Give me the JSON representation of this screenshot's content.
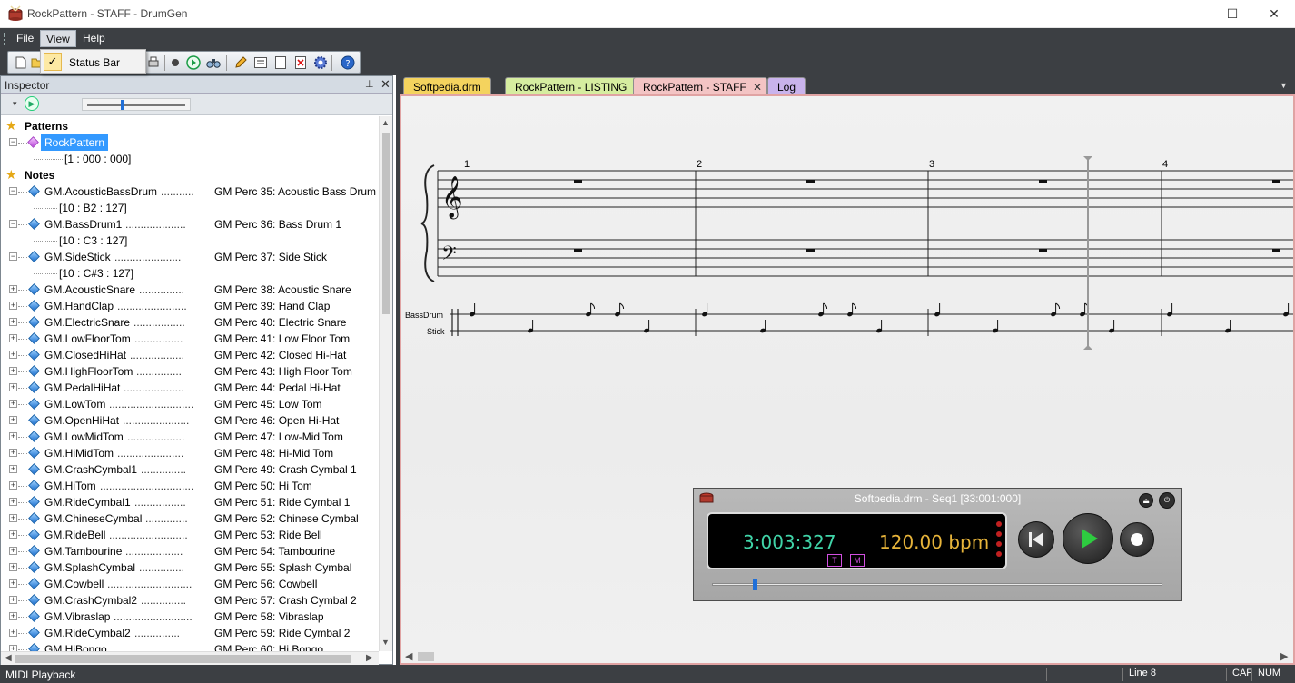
{
  "window": {
    "title": "RockPattern - STAFF - DrumGen",
    "minimize_glyph": "—",
    "maximize_glyph": "☐",
    "close_glyph": "✕"
  },
  "menu": {
    "items": [
      {
        "label": "File",
        "icon": "file-menu"
      },
      {
        "label": "View",
        "icon": "view-menu"
      },
      {
        "label": "Help",
        "icon": "help-menu"
      }
    ],
    "view_dropdown": {
      "checked_glyph": "✓",
      "item": "Status Bar"
    }
  },
  "toolbar": {
    "icons": [
      "new-file-icon",
      "open-folder-icon",
      "record-icon",
      "play-icon",
      "find-icon",
      "pencil-icon",
      "list-icon",
      "page-icon",
      "delete-icon",
      "settings-icon",
      "help-icon"
    ]
  },
  "inspector": {
    "title": "Inspector",
    "pin_glyph": "⊥",
    "close_glyph": "✕",
    "play_glyph": "▶",
    "dropdown_glyph": "▾",
    "tempo_slider_level": 0.36,
    "patterns_label": "Patterns",
    "pattern": {
      "name": "RockPattern",
      "detail": "[1 : 000 : 000]"
    },
    "notes_label": "Notes",
    "notes": [
      {
        "name": "GM.AcousticBassDrum",
        "dots": "...........",
        "desc": "GM Perc 35: Acoustic Bass Drum",
        "detail": "[10 : B2 : 127]"
      },
      {
        "name": "GM.BassDrum1",
        "dots": "....................",
        "desc": "GM Perc 36: Bass Drum 1",
        "detail": "[10 : C3 : 127]"
      },
      {
        "name": "GM.SideStick",
        "dots": "......................",
        "desc": "GM Perc 37: Side Stick",
        "detail": "[10 : C#3 : 127]"
      },
      {
        "name": "GM.AcousticSnare",
        "dots": "...............",
        "desc": "GM Perc 38: Acoustic Snare"
      },
      {
        "name": "GM.HandClap",
        "dots": ".......................",
        "desc": "GM Perc 39: Hand Clap"
      },
      {
        "name": "GM.ElectricSnare",
        "dots": ".................",
        "desc": "GM Perc 40: Electric Snare"
      },
      {
        "name": "GM.LowFloorTom",
        "dots": "................",
        "desc": "GM Perc 41: Low Floor Tom"
      },
      {
        "name": "GM.ClosedHiHat",
        "dots": "..................",
        "desc": "GM Perc 42: Closed Hi-Hat"
      },
      {
        "name": "GM.HighFloorTom",
        "dots": "...............",
        "desc": "GM Perc 43: High Floor Tom"
      },
      {
        "name": "GM.PedalHiHat",
        "dots": "....................",
        "desc": "GM Perc 44: Pedal Hi-Hat"
      },
      {
        "name": "GM.LowTom",
        "dots": "............................",
        "desc": "GM Perc 45: Low Tom"
      },
      {
        "name": "GM.OpenHiHat",
        "dots": "......................",
        "desc": "GM Perc 46: Open Hi-Hat"
      },
      {
        "name": "GM.LowMidTom",
        "dots": "...................",
        "desc": "GM Perc 47: Low-Mid Tom"
      },
      {
        "name": "GM.HiMidTom",
        "dots": "......................",
        "desc": "GM Perc 48: Hi-Mid Tom"
      },
      {
        "name": "GM.CrashCymbal1",
        "dots": "...............",
        "desc": "GM Perc 49: Crash Cymbal 1"
      },
      {
        "name": "GM.HiTom",
        "dots": "...............................",
        "desc": "GM Perc 50: Hi Tom"
      },
      {
        "name": "GM.RideCymbal1",
        "dots": ".................",
        "desc": "GM Perc 51: Ride Cymbal 1"
      },
      {
        "name": "GM.ChineseCymbal",
        "dots": "..............",
        "desc": "GM Perc 52: Chinese Cymbal"
      },
      {
        "name": "GM.RideBell",
        "dots": "..........................",
        "desc": "GM Perc 53: Ride Bell"
      },
      {
        "name": "GM.Tambourine",
        "dots": "...................",
        "desc": "GM Perc 54: Tambourine"
      },
      {
        "name": "GM.SplashCymbal",
        "dots": "...............",
        "desc": "GM Perc 55: Splash Cymbal"
      },
      {
        "name": "GM.Cowbell",
        "dots": "............................",
        "desc": "GM Perc 56: Cowbell"
      },
      {
        "name": "GM.CrashCymbal2",
        "dots": "...............",
        "desc": "GM Perc 57: Crash Cymbal 2"
      },
      {
        "name": "GM.Vibraslap",
        "dots": "..........................",
        "desc": "GM Perc 58: Vibraslap"
      },
      {
        "name": "GM.RideCymbal2",
        "dots": "...............",
        "desc": "GM Perc 59: Ride Cymbal 2"
      },
      {
        "name": "GM.HiBongo",
        "dots": "...........................",
        "desc": "GM Perc 60: Hi Bongo"
      }
    ]
  },
  "tabs": [
    {
      "label": "Softpedia.drm",
      "color": "#f4d35e",
      "active": false
    },
    {
      "label": "RockPattern - LISTING",
      "color": "#d6eda0",
      "active": false
    },
    {
      "label": "RockPattern - STAFF",
      "color": "#f3c4c4",
      "active": true
    },
    {
      "label": "Log",
      "color": "#c9b3ec",
      "active": false
    }
  ],
  "tab_close_glyph": "✕",
  "tabs_dropdown_glyph": "▼",
  "staff": {
    "measure_numbers": [
      "1",
      "2",
      "3",
      "4"
    ],
    "tracks": [
      "BassDrum",
      "Stick"
    ]
  },
  "transport": {
    "title": "Softpedia.drm - Seq1 [33:001:000]",
    "time": "3:003:327",
    "tempo": "120.00 bpm",
    "badges": [
      "T",
      "M"
    ],
    "eject_glyph": "⏏",
    "power_glyph": "⏻",
    "position_level": 0.09
  },
  "statusbar": {
    "message": "MIDI Playback",
    "line": "Line 8",
    "caps": "CAP",
    "num": "NUM"
  },
  "colors": {
    "chrome_dark": "#3c3f43",
    "selection": "#3399ff",
    "lcd_time": "#40d4a8",
    "lcd_tempo": "#e7b43a",
    "play_green": "#2ecc40"
  }
}
